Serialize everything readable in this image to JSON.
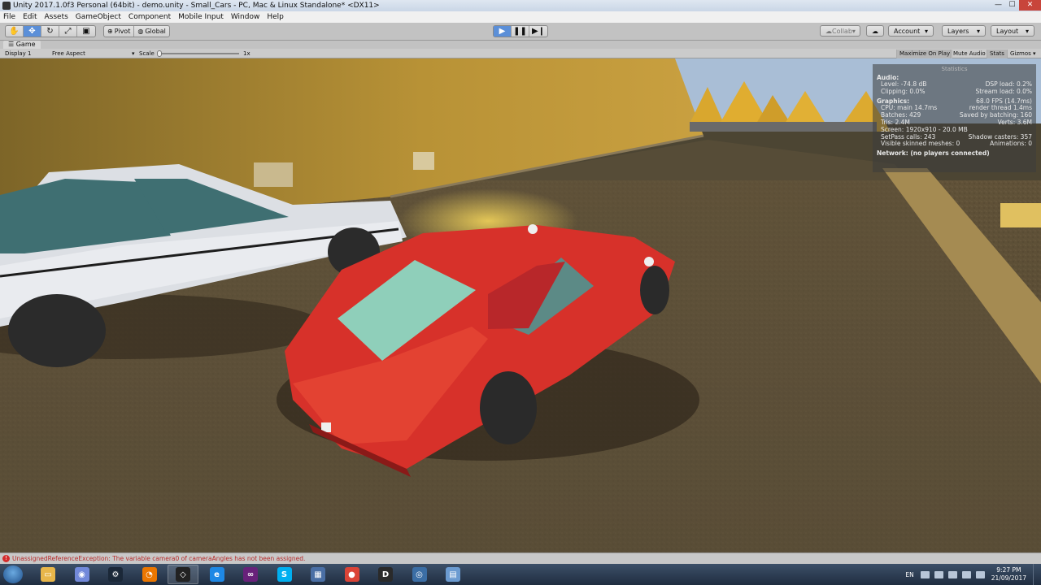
{
  "window": {
    "title": "Unity 2017.1.0f3 Personal (64bit) - demo.unity - Small_Cars - PC, Mac & Linux Standalone* <DX11>"
  },
  "menu": [
    "File",
    "Edit",
    "Assets",
    "GameObject",
    "Component",
    "Mobile Input",
    "Window",
    "Help"
  ],
  "toolbar": {
    "pivot_label": "Pivot",
    "global_label": "Global",
    "collab_label": "Collab",
    "account_label": "Account",
    "layers_label": "Layers",
    "layout_label": "Layout"
  },
  "game_tab": {
    "tab_label": "Game",
    "display": "Display 1",
    "aspect": "Free Aspect",
    "scale_label": "Scale",
    "scale_value": "1x",
    "maximize_on_play": "Maximize On Play",
    "mute_audio": "Mute Audio",
    "stats": "Stats",
    "gizmos": "Gizmos"
  },
  "statistics": {
    "title": "Statistics",
    "audio_heading": "Audio:",
    "audio_rows": [
      [
        "Level: -74.8 dB",
        "DSP load: 0.2%"
      ],
      [
        "Clipping: 0.0%",
        "Stream load: 0.0%"
      ]
    ],
    "graphics_heading": "Graphics:",
    "fps": "68.0 FPS (14.7ms)",
    "graphics_rows": [
      [
        "CPU: main 14.7ms",
        "render thread 1.4ms"
      ],
      [
        "Batches: 429",
        "Saved by batching: 160"
      ],
      [
        "Tris: 2.4M",
        "Verts: 3.6M"
      ],
      [
        "Screen: 1920x910 - 20.0 MB",
        ""
      ],
      [
        "SetPass calls: 243",
        "Shadow casters: 357"
      ],
      [
        "Visible skinned meshes: 0",
        "Animations: 0"
      ]
    ],
    "network": "Network: (no players connected)"
  },
  "console": {
    "message": "UnassignedReferenceException: The variable camera0 of cameraAngles has not been assigned."
  },
  "taskbar": {
    "apps": [
      {
        "name": "explorer",
        "color": "#e8b64a",
        "glyph": "▭"
      },
      {
        "name": "discord",
        "color": "#7289da",
        "glyph": "◉"
      },
      {
        "name": "steam",
        "color": "#1b2838",
        "glyph": "⚙"
      },
      {
        "name": "blender",
        "color": "#ea7600",
        "glyph": "◔"
      },
      {
        "name": "unity",
        "color": "#222222",
        "glyph": "◇"
      },
      {
        "name": "edge",
        "color": "#1e88e5",
        "glyph": "e"
      },
      {
        "name": "visual-studio",
        "color": "#68217a",
        "glyph": "∞"
      },
      {
        "name": "skype",
        "color": "#00aff0",
        "glyph": "S"
      },
      {
        "name": "paint",
        "color": "#4a6fa5",
        "glyph": "▦"
      },
      {
        "name": "chrome",
        "color": "#db4437",
        "glyph": "●"
      },
      {
        "name": "doom",
        "color": "#2a2a2a",
        "glyph": "D"
      },
      {
        "name": "app-blue",
        "color": "#3b6ea5",
        "glyph": "◎"
      },
      {
        "name": "notepad",
        "color": "#6b9bd1",
        "glyph": "▤"
      }
    ],
    "language": "EN",
    "time": "9:27 PM",
    "date": "21/09/2017"
  },
  "scene_colors": {
    "ground": "#5b4e38",
    "wall": "#a88a3a",
    "red_car": "#d8322a",
    "white_car": "#dadde2",
    "sky": "#9ab6d4"
  }
}
